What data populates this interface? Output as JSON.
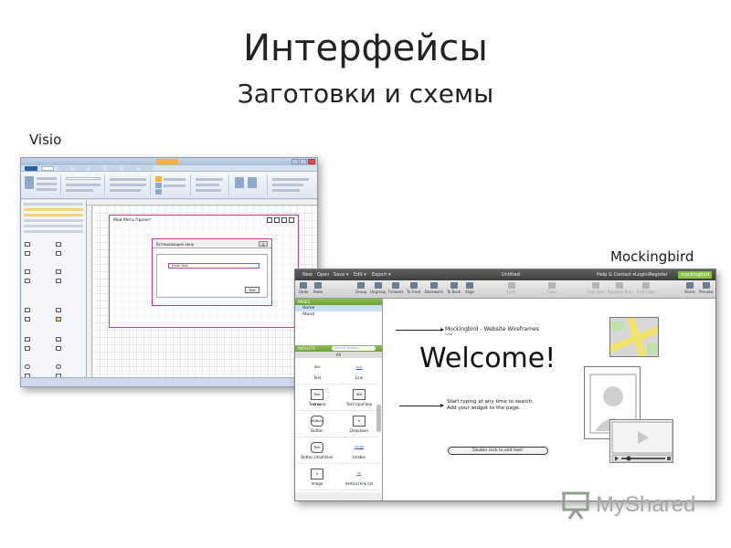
{
  "slide": {
    "title": "Интерфейсы",
    "subtitle": "Заготовки и схемы",
    "label_visio": "Visio",
    "label_mockingbird": "Mockingbird"
  },
  "visio": {
    "page_title": "Мой Мега Проект",
    "dialog_title": "Всплывающее окно",
    "dialog_close": "x",
    "input_text": "Enter Text",
    "button_text": "Text"
  },
  "mockingbird": {
    "menu": [
      "New",
      "Open",
      "Save ▾",
      "Edit ▾",
      "Export ▾"
    ],
    "document_name": "Untitled",
    "help_contact": "Help & Contact ▾",
    "login": "Login/Register",
    "logo": "mockingbird",
    "toolbar": {
      "left": [
        "Undo",
        "Redo"
      ],
      "middle": [
        "Group",
        "Ungroup",
        "Forward",
        "To Front",
        "Backward",
        "To Back",
        "Align"
      ],
      "dim": [
        "Lock",
        "Color",
        "Font Size",
        "Autosize Text",
        "Font Color"
      ],
      "right": [
        "Share",
        "Preview"
      ]
    },
    "pages_header": "PAGES",
    "pages": [
      "Home",
      "About"
    ],
    "widgets_header": "WIDGETS",
    "search_placeholder": "Search widgets",
    "category": "All",
    "widgets": [
      {
        "icon": "Text",
        "label": "Text",
        "style": "plain"
      },
      {
        "icon": "Link",
        "label": "Link",
        "style": "link"
      },
      {
        "icon": "Text Area",
        "label": "Text area",
        "style": "box"
      },
      {
        "icon": "Text",
        "label": "Text input box",
        "style": "box"
      },
      {
        "icon": "Button",
        "label": "Button",
        "style": "round"
      },
      {
        "icon": "▾",
        "label": "Dropdown",
        "style": "box"
      },
      {
        "icon": "Text",
        "label": "Button (multiline)",
        "style": "box"
      },
      {
        "icon": "url|url",
        "label": "Linkbar",
        "style": "link"
      },
      {
        "icon": "✕",
        "label": "Image",
        "style": "box"
      },
      {
        "icon": "url",
        "label": "Vertical link list",
        "style": "link"
      }
    ],
    "canvas": {
      "heading": "Mockingbird - Website Wireframes",
      "url": "Dino",
      "welcome": "Welcome!",
      "note_line1": "Start typing at any time to search.",
      "note_line2": "Add your widget to the page.",
      "pill": "Double click to edit text!"
    }
  },
  "watermark": "MyShared"
}
